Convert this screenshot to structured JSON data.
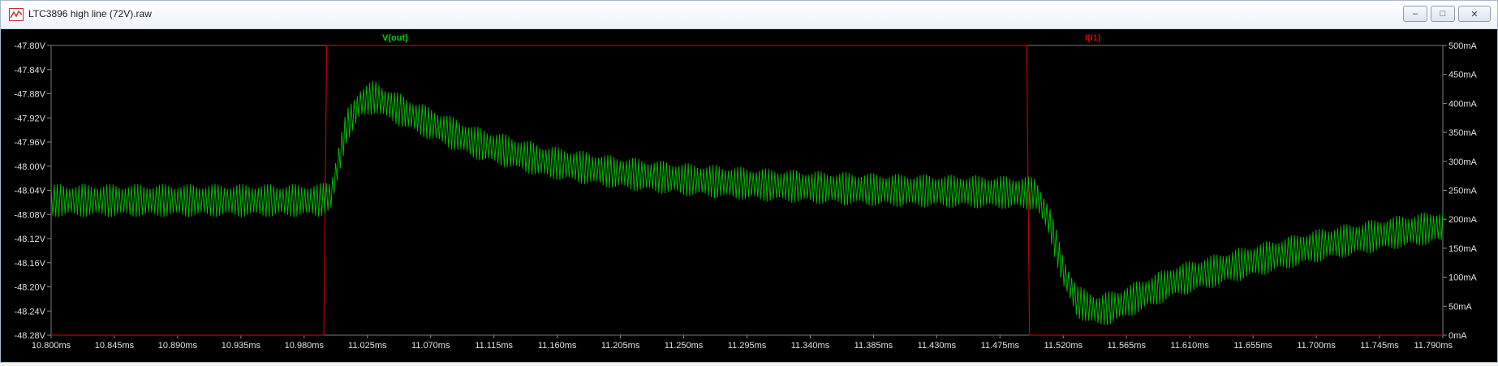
{
  "window": {
    "title": "LTC3896 high line (72V).raw",
    "controls": {
      "minimize": "–",
      "maximize": "□",
      "close": "✕"
    }
  },
  "chart_data": {
    "type": "line",
    "x_ticks": [
      "10.800ms",
      "10.845ms",
      "10.890ms",
      "10.935ms",
      "10.980ms",
      "11.025ms",
      "11.070ms",
      "11.115ms",
      "11.160ms",
      "11.205ms",
      "11.250ms",
      "11.295ms",
      "11.340ms",
      "11.385ms",
      "11.430ms",
      "11.475ms",
      "11.520ms",
      "11.565ms",
      "11.610ms",
      "11.655ms",
      "11.700ms",
      "11.745ms",
      "11.790ms"
    ],
    "left_ticks": [
      "-47.80V",
      "-47.84V",
      "-47.88V",
      "-47.92V",
      "-47.96V",
      "-48.00V",
      "-48.04V",
      "-48.08V",
      "-48.12V",
      "-48.16V",
      "-48.20V",
      "-48.24V",
      "-48.28V"
    ],
    "right_ticks": [
      "500mA",
      "450mA",
      "400mA",
      "350mA",
      "300mA",
      "250mA",
      "200mA",
      "150mA",
      "100mA",
      "50mA",
      "0mA"
    ],
    "xlim": [
      10.8,
      11.79
    ],
    "ylim_left": [
      -48.28,
      -47.8
    ],
    "ylim_right": [
      0,
      500
    ],
    "grid": false,
    "series": [
      {
        "name": "V(out)",
        "axis": "left",
        "color": "#00c000",
        "x": [
          10.8,
          10.99,
          10.999,
          11.01,
          11.02,
          11.03,
          11.04,
          11.06,
          11.1,
          11.15,
          11.2,
          11.25,
          11.3,
          11.35,
          11.4,
          11.45,
          11.5,
          11.51,
          11.52,
          11.53,
          11.545,
          11.56,
          11.6,
          11.65,
          11.7,
          11.75,
          11.79
        ],
        "y": [
          -48.057,
          -48.057,
          -48.05,
          -47.935,
          -47.895,
          -47.885,
          -47.898,
          -47.92,
          -47.96,
          -47.992,
          -48.01,
          -48.022,
          -48.03,
          -48.036,
          -48.04,
          -48.042,
          -48.045,
          -48.09,
          -48.175,
          -48.225,
          -48.24,
          -48.23,
          -48.19,
          -48.16,
          -48.132,
          -48.112,
          -48.1
        ],
        "ripple_pp": 0.055
      },
      {
        "name": "I(I1)",
        "axis": "right",
        "color": "#c00000",
        "x": [
          10.8,
          10.994,
          10.996,
          11.494,
          11.496,
          11.79
        ],
        "y": [
          0,
          0,
          500,
          500,
          0,
          0
        ]
      }
    ]
  }
}
